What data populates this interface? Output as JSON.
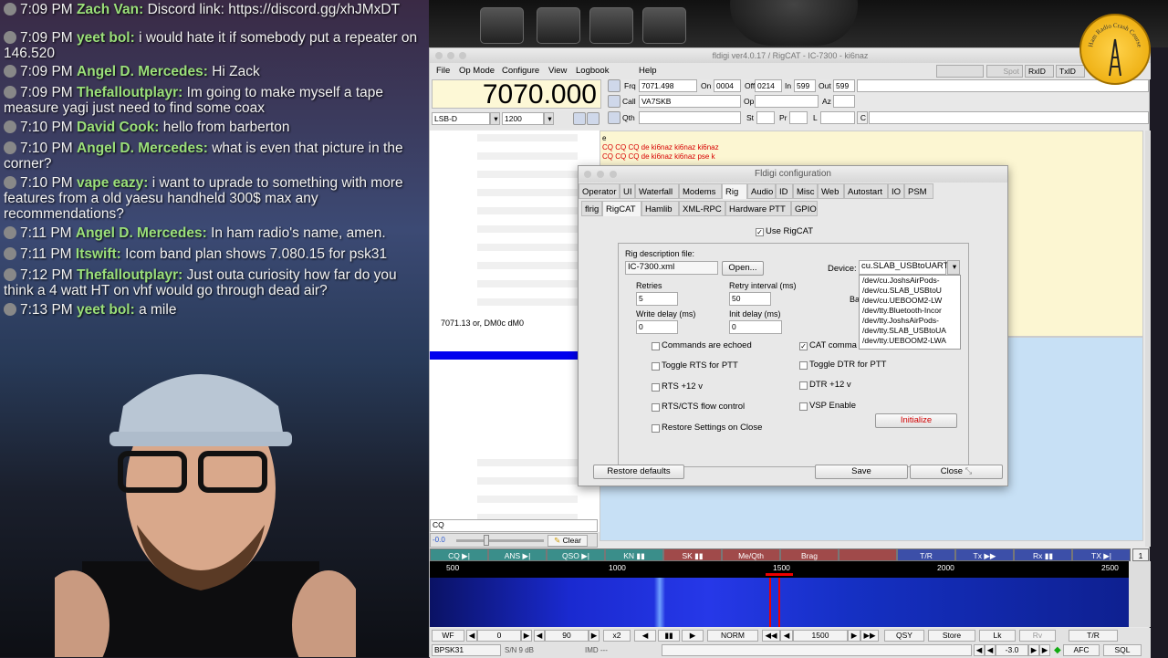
{
  "chat": [
    {
      "time": "7:09 PM",
      "user": "Zach Van:",
      "text": "Discord link: https://discord.gg/xhJMxDT"
    },
    {
      "time": "7:09 PM",
      "user": "yeet bol:",
      "text": "i would hate it if somebody put a repeater on 146.520"
    },
    {
      "time": "7:09 PM",
      "user": "Angel D. Mercedes:",
      "text": "Hi Zack"
    },
    {
      "time": "7:09 PM",
      "user": "Thefalloutplayr:",
      "text": "Im going to make myself a tape measure yagi just need to find some coax"
    },
    {
      "time": "7:10 PM",
      "user": "David Cook:",
      "text": "hello from barberton"
    },
    {
      "time": "7:10 PM",
      "user": "Angel D. Mercedes:",
      "text": "what is even that picture in the corner?"
    },
    {
      "time": "7:10 PM",
      "user": "vape eazy:",
      "text": "i want to uprade to something with more features from a old yaesu handheld 300$ max any recommendations?"
    },
    {
      "time": "7:11 PM",
      "user": "Angel D. Mercedes:",
      "text": "In ham radio's name, amen."
    },
    {
      "time": "7:11 PM",
      "user": "Itswift:",
      "text": "Icom band plan shows 7.080.15 for psk31"
    },
    {
      "time": "7:12 PM",
      "user": "Thefalloutplayr:",
      "text": "Just outa curiosity how far do you think a 4 watt HT on vhf would go through dead air?"
    },
    {
      "time": "7:13 PM",
      "user": "yeet bol:",
      "text": "a mile"
    }
  ],
  "fldigi": {
    "title": "fldigi ver4.0.17 / RigCAT - IC-7300 - ki6naz",
    "menu": [
      "File",
      "Op Mode",
      "Configure",
      "View",
      "Logbook",
      "Help"
    ],
    "top_buttons": [
      "Spot",
      "RxID",
      "TxID"
    ],
    "freq": "7070.000",
    "fields": {
      "frq_label": "Frq",
      "frq": "7071.498",
      "on_label": "On",
      "on": "0004",
      "off_label": "Off",
      "off": "0214",
      "in_label": "In",
      "in": "599",
      "out_label": "Out",
      "out": "599",
      "call_label": "Call",
      "call": "VA7SKB",
      "op_label": "Op",
      "az_label": "Az",
      "qth_label": "Qth",
      "st_label": "St",
      "pr_label": "Pr",
      "l_label": "L",
      "c_label": "C"
    },
    "mode": "LSB-D",
    "bandwidth": "1200",
    "rx_lines": [
      "e",
      "CQ CQ CQ de ki6naz ki6naz ki6naz",
      "CQ CQ CQ de ki6naz ki6naz pse k"
    ],
    "viewer_line": "7071.13 or, DM0c dM0",
    "cq_field": "CQ",
    "squelch_value": "-0.0",
    "clear_label": "Clear",
    "macros": [
      "CQ",
      "ANS",
      "QSO",
      "KN",
      "SK",
      "Me/Qth",
      "Brag",
      "",
      "T/R",
      "Tx",
      "Rx",
      "TX"
    ],
    "macro_page": "1",
    "scale_ticks": [
      "500",
      "1000",
      "1500",
      "2000",
      "2500"
    ],
    "wf_controls": {
      "wf": "WF",
      "start": "0",
      "range": "90",
      "zoom": "x2",
      "norm": "NORM",
      "freq": "1500",
      "qsy": "QSY",
      "store": "Store",
      "lk": "Lk",
      "rv": "Rv",
      "tr": "T/R"
    },
    "status": {
      "mode": "BPSK31",
      "sn": "S/N  9 dB",
      "imd": "IMD ---",
      "level": "-3.0",
      "afc": "AFC",
      "sql": "SQL"
    }
  },
  "config": {
    "title": "Fldigi configuration",
    "tabs": [
      "Operator",
      "UI",
      "Waterfall",
      "Modems",
      "Rig",
      "Audio",
      "ID",
      "Misc",
      "Web",
      "Autostart",
      "IO",
      "PSM"
    ],
    "subtabs": [
      "flrig",
      "RigCAT",
      "Hamlib",
      "XML-RPC",
      "Hardware PTT",
      "GPIO"
    ],
    "use_rigcat": "Use RigCAT",
    "rig_desc_label": "Rig description file:",
    "rig_desc_file": "IC-7300.xml",
    "open_label": "Open...",
    "device_label": "Device:",
    "device_value": "cu.SLAB_USBtoUART",
    "device_list": [
      "/dev/cu.JoshsAirPods-",
      "/dev/cu.SLAB_USBtoU",
      "/dev/cu.UEBOOM2-LW",
      "/dev/tty.Bluetooth-Incor",
      "/dev/tty.JoshsAirPods-",
      "/dev/tty.SLAB_USBtoUA",
      "/dev/tty.UEBOOM2-LWA"
    ],
    "baud_label": "Ba",
    "retries_label": "Retries",
    "retries": "5",
    "retry_interval_label": "Retry interval (ms)",
    "retry_interval": "50",
    "write_delay_label": "Write delay (ms)",
    "write_delay": "0",
    "init_delay_label": "Init delay (ms)",
    "init_delay": "0",
    "checks_left": [
      "Commands are echoed",
      "Toggle RTS for PTT",
      "RTS +12 v",
      "RTS/CTS flow control",
      "Restore Settings on Close"
    ],
    "checks_right": [
      "CAT comma",
      "Toggle DTR for PTT",
      "DTR +12 v",
      "VSP Enable"
    ],
    "initialize_label": "Initialize",
    "restore_label": "Restore defaults",
    "save_label": "Save",
    "close_label": "Close"
  },
  "logo_text": "Ham Radio Crash Course",
  "colors": {
    "accent_red": "#d80000",
    "rx_bg": "#fcf6d2",
    "tx_bg": "#c7e0f5",
    "chat_name": "#9be07a"
  }
}
